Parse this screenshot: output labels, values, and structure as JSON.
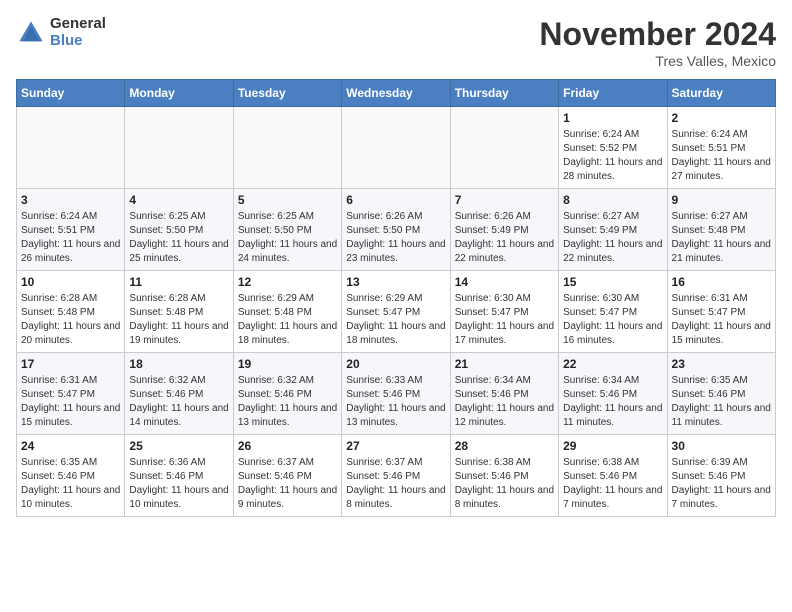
{
  "logo": {
    "general": "General",
    "blue": "Blue"
  },
  "header": {
    "month": "November 2024",
    "location": "Tres Valles, Mexico"
  },
  "weekdays": [
    "Sunday",
    "Monday",
    "Tuesday",
    "Wednesday",
    "Thursday",
    "Friday",
    "Saturday"
  ],
  "weeks": [
    [
      {
        "day": "",
        "info": ""
      },
      {
        "day": "",
        "info": ""
      },
      {
        "day": "",
        "info": ""
      },
      {
        "day": "",
        "info": ""
      },
      {
        "day": "",
        "info": ""
      },
      {
        "day": "1",
        "info": "Sunrise: 6:24 AM\nSunset: 5:52 PM\nDaylight: 11 hours and 28 minutes."
      },
      {
        "day": "2",
        "info": "Sunrise: 6:24 AM\nSunset: 5:51 PM\nDaylight: 11 hours and 27 minutes."
      }
    ],
    [
      {
        "day": "3",
        "info": "Sunrise: 6:24 AM\nSunset: 5:51 PM\nDaylight: 11 hours and 26 minutes."
      },
      {
        "day": "4",
        "info": "Sunrise: 6:25 AM\nSunset: 5:50 PM\nDaylight: 11 hours and 25 minutes."
      },
      {
        "day": "5",
        "info": "Sunrise: 6:25 AM\nSunset: 5:50 PM\nDaylight: 11 hours and 24 minutes."
      },
      {
        "day": "6",
        "info": "Sunrise: 6:26 AM\nSunset: 5:50 PM\nDaylight: 11 hours and 23 minutes."
      },
      {
        "day": "7",
        "info": "Sunrise: 6:26 AM\nSunset: 5:49 PM\nDaylight: 11 hours and 22 minutes."
      },
      {
        "day": "8",
        "info": "Sunrise: 6:27 AM\nSunset: 5:49 PM\nDaylight: 11 hours and 22 minutes."
      },
      {
        "day": "9",
        "info": "Sunrise: 6:27 AM\nSunset: 5:48 PM\nDaylight: 11 hours and 21 minutes."
      }
    ],
    [
      {
        "day": "10",
        "info": "Sunrise: 6:28 AM\nSunset: 5:48 PM\nDaylight: 11 hours and 20 minutes."
      },
      {
        "day": "11",
        "info": "Sunrise: 6:28 AM\nSunset: 5:48 PM\nDaylight: 11 hours and 19 minutes."
      },
      {
        "day": "12",
        "info": "Sunrise: 6:29 AM\nSunset: 5:48 PM\nDaylight: 11 hours and 18 minutes."
      },
      {
        "day": "13",
        "info": "Sunrise: 6:29 AM\nSunset: 5:47 PM\nDaylight: 11 hours and 18 minutes."
      },
      {
        "day": "14",
        "info": "Sunrise: 6:30 AM\nSunset: 5:47 PM\nDaylight: 11 hours and 17 minutes."
      },
      {
        "day": "15",
        "info": "Sunrise: 6:30 AM\nSunset: 5:47 PM\nDaylight: 11 hours and 16 minutes."
      },
      {
        "day": "16",
        "info": "Sunrise: 6:31 AM\nSunset: 5:47 PM\nDaylight: 11 hours and 15 minutes."
      }
    ],
    [
      {
        "day": "17",
        "info": "Sunrise: 6:31 AM\nSunset: 5:47 PM\nDaylight: 11 hours and 15 minutes."
      },
      {
        "day": "18",
        "info": "Sunrise: 6:32 AM\nSunset: 5:46 PM\nDaylight: 11 hours and 14 minutes."
      },
      {
        "day": "19",
        "info": "Sunrise: 6:32 AM\nSunset: 5:46 PM\nDaylight: 11 hours and 13 minutes."
      },
      {
        "day": "20",
        "info": "Sunrise: 6:33 AM\nSunset: 5:46 PM\nDaylight: 11 hours and 13 minutes."
      },
      {
        "day": "21",
        "info": "Sunrise: 6:34 AM\nSunset: 5:46 PM\nDaylight: 11 hours and 12 minutes."
      },
      {
        "day": "22",
        "info": "Sunrise: 6:34 AM\nSunset: 5:46 PM\nDaylight: 11 hours and 11 minutes."
      },
      {
        "day": "23",
        "info": "Sunrise: 6:35 AM\nSunset: 5:46 PM\nDaylight: 11 hours and 11 minutes."
      }
    ],
    [
      {
        "day": "24",
        "info": "Sunrise: 6:35 AM\nSunset: 5:46 PM\nDaylight: 11 hours and 10 minutes."
      },
      {
        "day": "25",
        "info": "Sunrise: 6:36 AM\nSunset: 5:46 PM\nDaylight: 11 hours and 10 minutes."
      },
      {
        "day": "26",
        "info": "Sunrise: 6:37 AM\nSunset: 5:46 PM\nDaylight: 11 hours and 9 minutes."
      },
      {
        "day": "27",
        "info": "Sunrise: 6:37 AM\nSunset: 5:46 PM\nDaylight: 11 hours and 8 minutes."
      },
      {
        "day": "28",
        "info": "Sunrise: 6:38 AM\nSunset: 5:46 PM\nDaylight: 11 hours and 8 minutes."
      },
      {
        "day": "29",
        "info": "Sunrise: 6:38 AM\nSunset: 5:46 PM\nDaylight: 11 hours and 7 minutes."
      },
      {
        "day": "30",
        "info": "Sunrise: 6:39 AM\nSunset: 5:46 PM\nDaylight: 11 hours and 7 minutes."
      }
    ]
  ]
}
